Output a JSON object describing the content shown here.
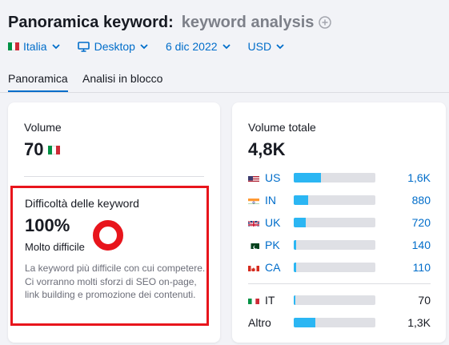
{
  "header": {
    "title": "Panoramica keyword:",
    "keyword": "keyword analysis"
  },
  "filters": {
    "country": "Italia",
    "device": "Desktop",
    "date": "6 dic 2022",
    "currency": "USD"
  },
  "tabs": [
    {
      "label": "Panoramica",
      "active": true
    },
    {
      "label": "Analisi in blocco",
      "active": false
    }
  ],
  "volume_card": {
    "label": "Volume",
    "value": "70"
  },
  "difficulty_card": {
    "label": "Difficoltà delle keyword",
    "value": "100%",
    "level": "Molto difficile",
    "percent": 100,
    "ring_color": "#e8151c",
    "description": "La keyword più difficile con cui competere. Ci vorranno molti sforzi di SEO on-page, link building e promozione dei contenuti."
  },
  "total_volume_card": {
    "label": "Volume totale",
    "value": "4,8K",
    "countries": [
      {
        "code": "US",
        "value": "1,6K",
        "share": 0.33
      },
      {
        "code": "IN",
        "value": "880",
        "share": 0.18
      },
      {
        "code": "UK",
        "value": "720",
        "share": 0.15
      },
      {
        "code": "PK",
        "value": "140",
        "share": 0.03
      },
      {
        "code": "CA",
        "value": "110",
        "share": 0.03
      }
    ],
    "local": {
      "code": "IT",
      "value": "70",
      "share": 0.015
    },
    "other": {
      "label": "Altro",
      "value": "1,3K",
      "share": 0.26
    }
  },
  "colors": {
    "accent": "#006dca",
    "bar_fill": "#2bb6f3",
    "highlight": "#e8151c"
  }
}
